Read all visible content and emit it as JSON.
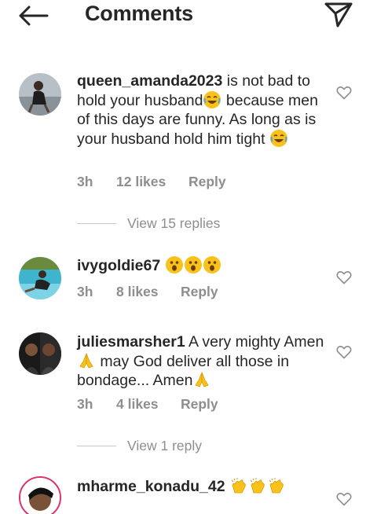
{
  "header": {
    "title": "Comments"
  },
  "comments": [
    {
      "username": "queen_amanda2023",
      "text_1": " is not bad to hold your husband",
      "text_2": " because men of this days are funny. As long as is your husband hold him tight ",
      "time": "3h",
      "likes": "12 likes",
      "reply": "Reply",
      "view_replies": "View 15 replies"
    },
    {
      "username": "ivygoldie67",
      "time": "3h",
      "likes": "8 likes",
      "reply": "Reply"
    },
    {
      "username": "juliesmarsher1",
      "text_1": " A very mighty Amen",
      "text_2": "  may God deliver all those in bondage... Amen",
      "time": "3h",
      "likes": "4 likes",
      "reply": "Reply",
      "view_replies": "View 1 reply"
    },
    {
      "username": "mharme_konadu_42"
    }
  ],
  "colors": {
    "text": "#262626",
    "muted": "#8e8e8e",
    "divider": "#c7c7c7",
    "emoji": "#f9c21a"
  },
  "icons": [
    "back-arrow-icon",
    "send-icon",
    "heart-icon",
    "laughing-emoji",
    "astonished-emoji",
    "praying-hands-emoji",
    "clapping-hands-emoji"
  ]
}
